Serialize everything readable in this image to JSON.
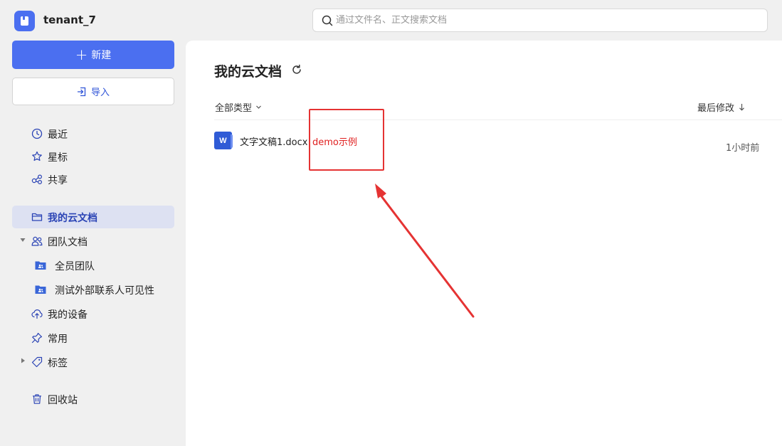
{
  "header": {
    "tenant": "tenant_7",
    "search_placeholder": "通过文件名、正文搜索文档"
  },
  "sidebar": {
    "new_label": "新建",
    "import_label": "导入",
    "items": [
      {
        "label": "最近",
        "icon": "clock-icon"
      },
      {
        "label": "星标",
        "icon": "star-icon"
      },
      {
        "label": "共享",
        "icon": "share-icon"
      },
      {
        "label": "我的云文档",
        "icon": "folder-icon",
        "active": true
      },
      {
        "label": "团队文档",
        "icon": "team-icon"
      },
      {
        "label": "全员团队",
        "icon": "team-folder-icon"
      },
      {
        "label": "测试外部联系人可见性",
        "icon": "team-folder-icon"
      },
      {
        "label": "我的设备",
        "icon": "cloud-upload-icon"
      },
      {
        "label": "常用",
        "icon": "pin-icon"
      },
      {
        "label": "标签",
        "icon": "tag-icon"
      },
      {
        "label": "回收站",
        "icon": "trash-icon"
      }
    ]
  },
  "main": {
    "title": "我的云文档",
    "filter_type": "全部类型",
    "sort_label": "最后修改",
    "files": [
      {
        "name": "文字文稿1.docx",
        "annotation": "demo示例",
        "modified": "1小时前",
        "icon": "word-icon",
        "icon_letter": "W"
      }
    ]
  },
  "colors": {
    "accent": "#4b6ff0",
    "annotation_red": "#e53333",
    "active_bg": "#dde1f2"
  }
}
